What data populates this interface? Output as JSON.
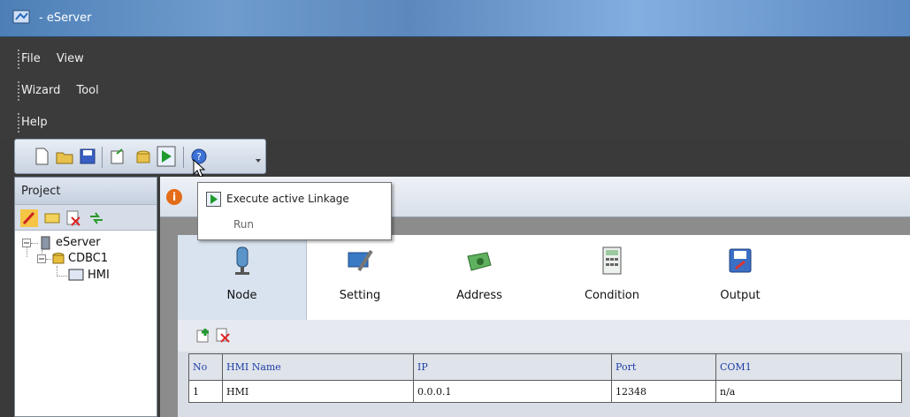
{
  "window": {
    "title": "- eServer"
  },
  "menu": {
    "row1": [
      "File",
      "View"
    ],
    "row2": [
      "Wizard",
      "Tool"
    ],
    "row3": [
      "Help"
    ]
  },
  "toolbar": {
    "buttons": [
      "new-file-icon",
      "open-folder-icon",
      "save-icon",
      "export-icon",
      "wizard-icon",
      "execute-icon",
      "help-icon"
    ]
  },
  "project": {
    "header": "Project",
    "tree": {
      "root": "eServer",
      "child": "CDBC1",
      "leaf": "HMI"
    }
  },
  "tooltip": {
    "title": "Execute active Linkage",
    "subtitle": "Run"
  },
  "tabs": [
    {
      "label": "Node",
      "icon": "node-icon"
    },
    {
      "label": "Setting",
      "icon": "setting-icon"
    },
    {
      "label": "Address",
      "icon": "address-icon"
    },
    {
      "label": "Condition",
      "icon": "condition-icon"
    },
    {
      "label": "Output",
      "icon": "output-icon"
    }
  ],
  "table": {
    "columns": [
      "No",
      "HMI Name",
      "IP",
      "Port",
      "COM1"
    ],
    "rows": [
      [
        "1",
        "HMI",
        "0.0.0.1",
        "12348",
        "n/a"
      ]
    ]
  }
}
